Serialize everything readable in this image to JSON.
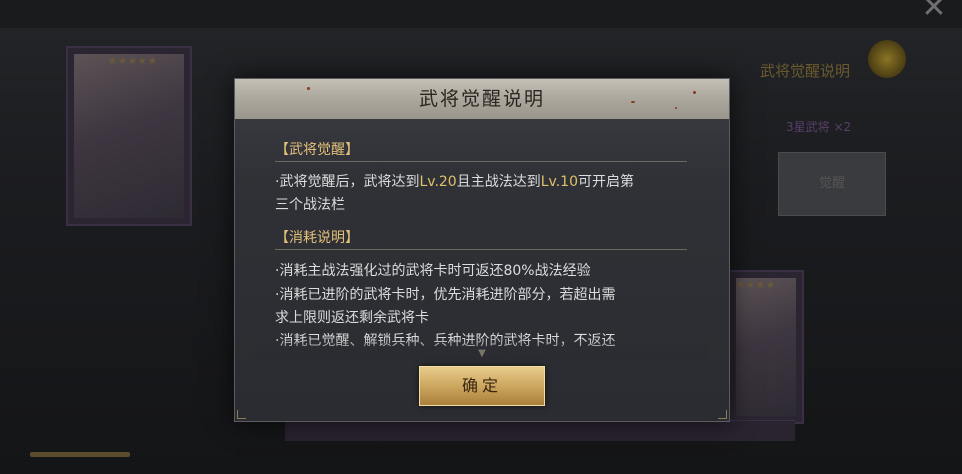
{
  "background": {
    "right_panel_title": "武将觉醒说明",
    "right_panel_sub": "3星武将 ×2",
    "right_panel_box": "觉醒"
  },
  "modal": {
    "title": "武将觉醒说明",
    "sections": [
      {
        "heading": "【武将觉醒】",
        "lines": [
          {
            "before": "·武将觉醒后，武将达到",
            "lv1": "Lv.20",
            "middle": "且主战法达到",
            "lv2": "Lv.10",
            "after": "可开启第"
          },
          {
            "text": "三个战法栏"
          }
        ]
      },
      {
        "heading": "【消耗说明】",
        "lines": [
          {
            "text": "·消耗主战法强化过的武将卡时可返还80%战法经验"
          },
          {
            "text": "·消耗已进阶的武将卡时，优先消耗进阶部分，若超出需"
          },
          {
            "text": "求上限则返还剩余武将卡"
          },
          {
            "text": "·消耗已觉醒、解锁兵种、兵种进阶的武将卡时，不返还"
          }
        ]
      }
    ],
    "confirm_label": "确定"
  },
  "icons": {
    "close": "close-icon",
    "scroll": "chevron-down-icon"
  }
}
